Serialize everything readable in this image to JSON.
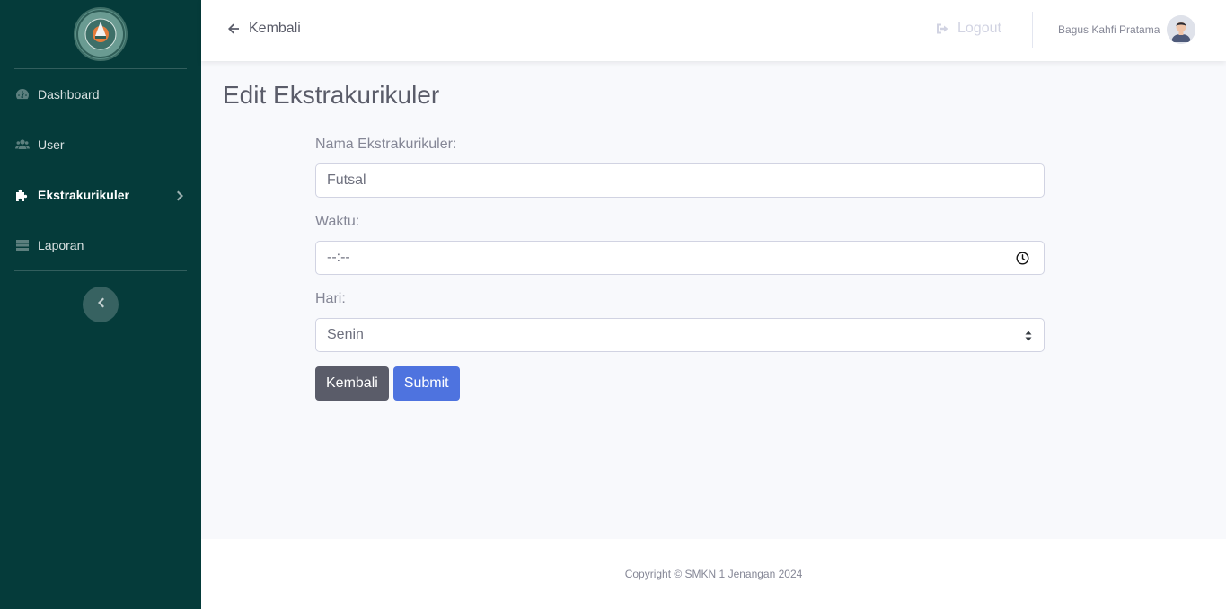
{
  "sidebar": {
    "logo_icon": "school-logo-icon",
    "items": [
      {
        "label": "Dashboard",
        "icon": "tachometer-icon",
        "active": false
      },
      {
        "label": "User",
        "icon": "users-icon",
        "active": false
      },
      {
        "label": "Ekstrakurikuler",
        "icon": "puzzle-icon",
        "active": true
      },
      {
        "label": "Laporan",
        "icon": "table-icon",
        "active": false
      }
    ],
    "toggle_icon": "chevron-left-icon"
  },
  "topbar": {
    "back_label": "Kembali",
    "logout_label": "Logout",
    "user_name": "Bagus Kahfi Pratama"
  },
  "page": {
    "title": "Edit Ekstrakurikuler"
  },
  "form": {
    "nama_label": "Nama Ekstrakurikuler:",
    "nama_value": "Futsal",
    "waktu_label": "Waktu:",
    "waktu_value": "--:--",
    "hari_label": "Hari:",
    "hari_value": "Senin",
    "kembali_label": "Kembali",
    "submit_label": "Submit"
  },
  "footer": {
    "text": "Copyright © SMKN 1 Jenangan 2024"
  },
  "colors": {
    "sidebar_bg": "#053b3a",
    "primary": "#4e73df",
    "secondary": "#5a5c69",
    "page_bg": "#f8f9fc"
  }
}
